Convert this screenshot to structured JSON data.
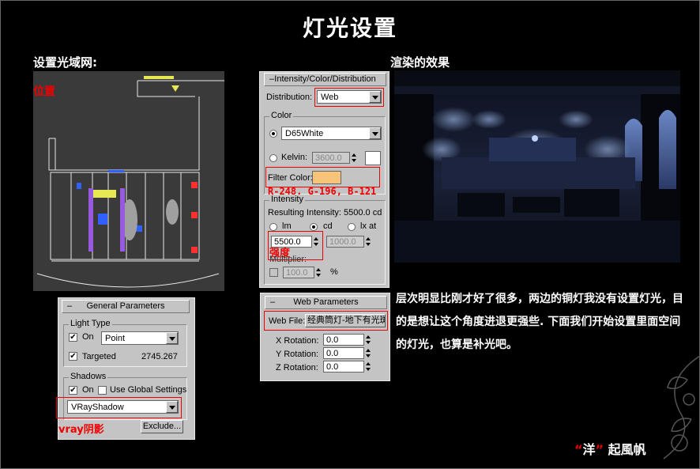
{
  "page": {
    "title": "灯光设置"
  },
  "left_heading": "设置光域网:",
  "right_heading": "渲染的效果",
  "viewport": {
    "position_label": "位置"
  },
  "intensity_panel": {
    "header": "Intensity/Color/Distribution",
    "distribution_label": "Distribution:",
    "distribution_value": "Web",
    "color_group": "Color",
    "color_preset": "D65White",
    "kelvin_label": "Kelvin:",
    "kelvin_value": "3600.0",
    "filter_color_label": "Filter Color:",
    "filter_color_hex": "#f8c479",
    "filter_annotation": "R-248, G-196, B-121",
    "intensity_group": "Intensity",
    "resulting_intensity": "Resulting Intensity: 5500.0 cd",
    "unit_lm": "lm",
    "unit_cd": "cd",
    "unit_lx": "lx at",
    "intensity_value": "5500.0",
    "lx_distance": "1000.0",
    "strength_annotation": "强度",
    "multiplier_label": "Multiplier:",
    "multiplier_value": "100.0",
    "percent": "%"
  },
  "web_panel": {
    "header": "Web Parameters",
    "web_file_label": "Web File:",
    "web_file_value": "经典筒灯-地下有光斑",
    "x_rotation_label": "X Rotation:",
    "x_rotation": "0.0",
    "y_rotation_label": "Y Rotation:",
    "y_rotation": "0.0",
    "z_rotation_label": "Z Rotation:",
    "z_rotation": "0.0"
  },
  "general_panel": {
    "header": "General Parameters",
    "light_type_group": "Light Type",
    "on_label": "On",
    "light_type": "Point",
    "targeted_label": "Targeted",
    "target_distance": "2745.267",
    "shadows_group": "Shadows",
    "shadows_on_label": "On",
    "use_global_label": "Use Global Settings",
    "shadow_type": "VRayShadow",
    "vray_annotation": "vray阴影",
    "exclude_button": "Exclude..."
  },
  "description": "层次明显比刚才好了很多，两边的铜灯我没有设置灯光，目的是想让这个角度进退更强些. 下面我们开始设置里面空间的灯光，也算是补光吧。",
  "signature": {
    "open_quote": "“",
    "name_mark": "洋",
    "close_quote": "”",
    "rest": " 起風帆"
  },
  "colors": {
    "annotation_red": "#ee0000",
    "panel_gray": "#c4c4c4",
    "viewport_gray": "#3a3a3a"
  }
}
